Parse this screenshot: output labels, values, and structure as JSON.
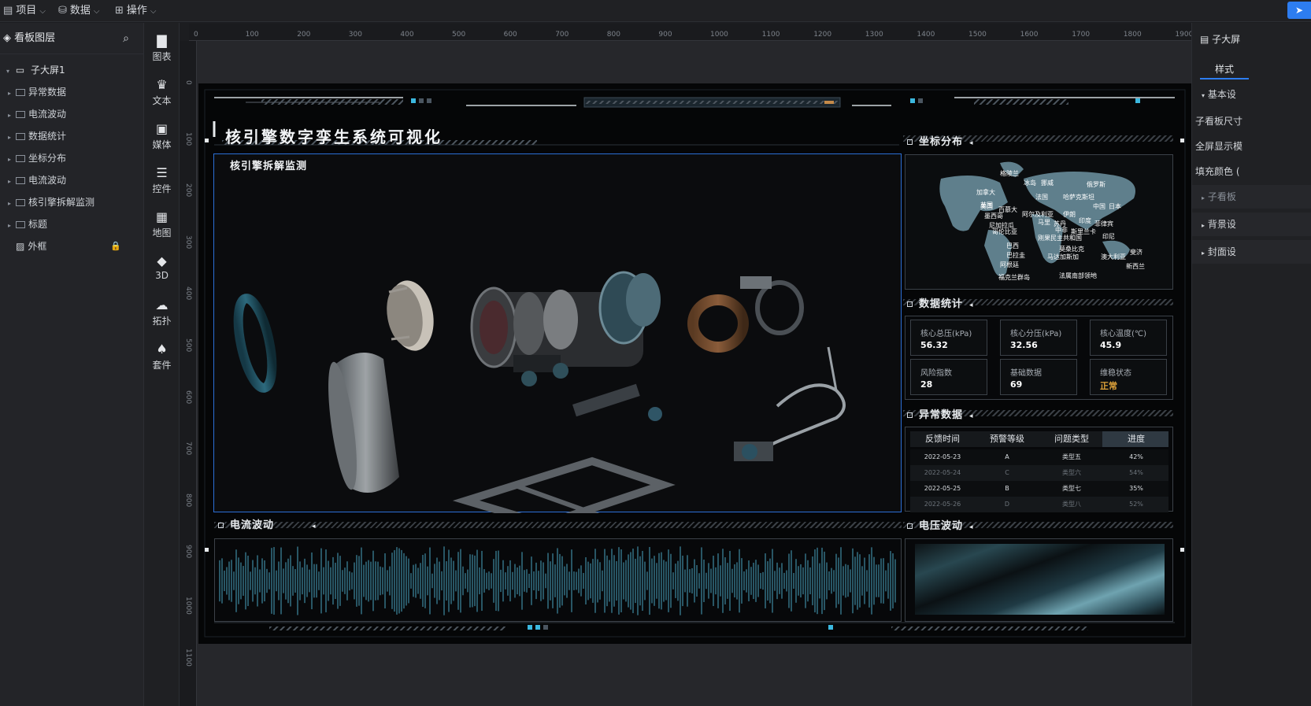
{
  "menu": {
    "project": "项目",
    "data": "数据",
    "operate": "操作"
  },
  "layers": {
    "title": "看板图层",
    "root": "子大屏1",
    "items": [
      "异常数据",
      "电流波动",
      "数据统计",
      "坐标分布",
      "电流波动",
      "核引擎拆解监测",
      "标题",
      "外框"
    ]
  },
  "tools": [
    "图表",
    "文本",
    "媒体",
    "控件",
    "地图",
    "3D",
    "拓扑",
    "套件"
  ],
  "ruler": {
    "top": [
      "0",
      "100",
      "200",
      "300",
      "400",
      "500",
      "600",
      "700",
      "800",
      "900",
      "1000",
      "1100",
      "1200",
      "1300",
      "1400",
      "1500",
      "1600",
      "1700",
      "1800",
      "1900"
    ],
    "left": [
      "0",
      "100",
      "200",
      "300",
      "400",
      "500",
      "600",
      "700",
      "800",
      "900",
      "1000",
      "1100"
    ]
  },
  "right_panel": {
    "title": "子大屏",
    "tab": "样式",
    "section_basic": "基本设",
    "rows": [
      "子看板尺寸",
      "全屏显示模",
      "填充颜色 ("
    ],
    "collapsed": [
      "子看板",
      "背景设",
      "封面设"
    ]
  },
  "screen": {
    "title": "核引擎数字孪生系统可视化",
    "monitor_title": "核引擎拆解监测",
    "map_title": "坐标分布",
    "stats_title": "数据统计",
    "abnormal_title": "异常数据",
    "current_title": "电流波动",
    "voltage_title": "电压波动"
  },
  "stats": [
    {
      "label": "核心总压(kPa)",
      "value": "56.32"
    },
    {
      "label": "核心分压(kPa)",
      "value": "32.56"
    },
    {
      "label": "核心温度(℃)",
      "value": "45.9"
    },
    {
      "label": "风险指数",
      "value": "28"
    },
    {
      "label": "基础数据",
      "value": "69"
    },
    {
      "label": "维稳状态",
      "value": "正常"
    }
  ],
  "table": {
    "headers": [
      "反馈时间",
      "预警等级",
      "问题类型",
      "进度"
    ],
    "rows": [
      [
        "2022-05-23",
        "A",
        "类型五",
        "42%"
      ],
      [
        "2022-05-24",
        "C",
        "类型六",
        "54%"
      ],
      [
        "2022-05-25",
        "B",
        "类型七",
        "35%"
      ],
      [
        "2022-05-26",
        "D",
        "类型八",
        "52%"
      ]
    ]
  },
  "map_labels": [
    "格陵兰",
    "冰岛",
    "挪威",
    "俄罗斯",
    "加拿大",
    "英国",
    "法国",
    "哈萨克斯坦",
    "美国",
    "百慕大",
    "中国",
    "日本",
    "墨西哥",
    "阿尔及利亚",
    "伊朗",
    "尼加拉瓜",
    "马里",
    "苏丹",
    "印度",
    "菲律宾",
    "哥伦比亚",
    "中非",
    "斯里兰卡",
    "刚果民主共和国",
    "印尼",
    "巴西",
    "莫桑比克",
    "巴拉圭",
    "马达加斯加",
    "澳大利亚",
    "斐济",
    "阿根廷",
    "新西兰",
    "福克兰群岛",
    "法属南部领地"
  ],
  "colors": {
    "accent": "#2d7df0",
    "screen_bg": "#050607",
    "wave": "#3f8aa2",
    "status_ok": "#e0a33a"
  }
}
